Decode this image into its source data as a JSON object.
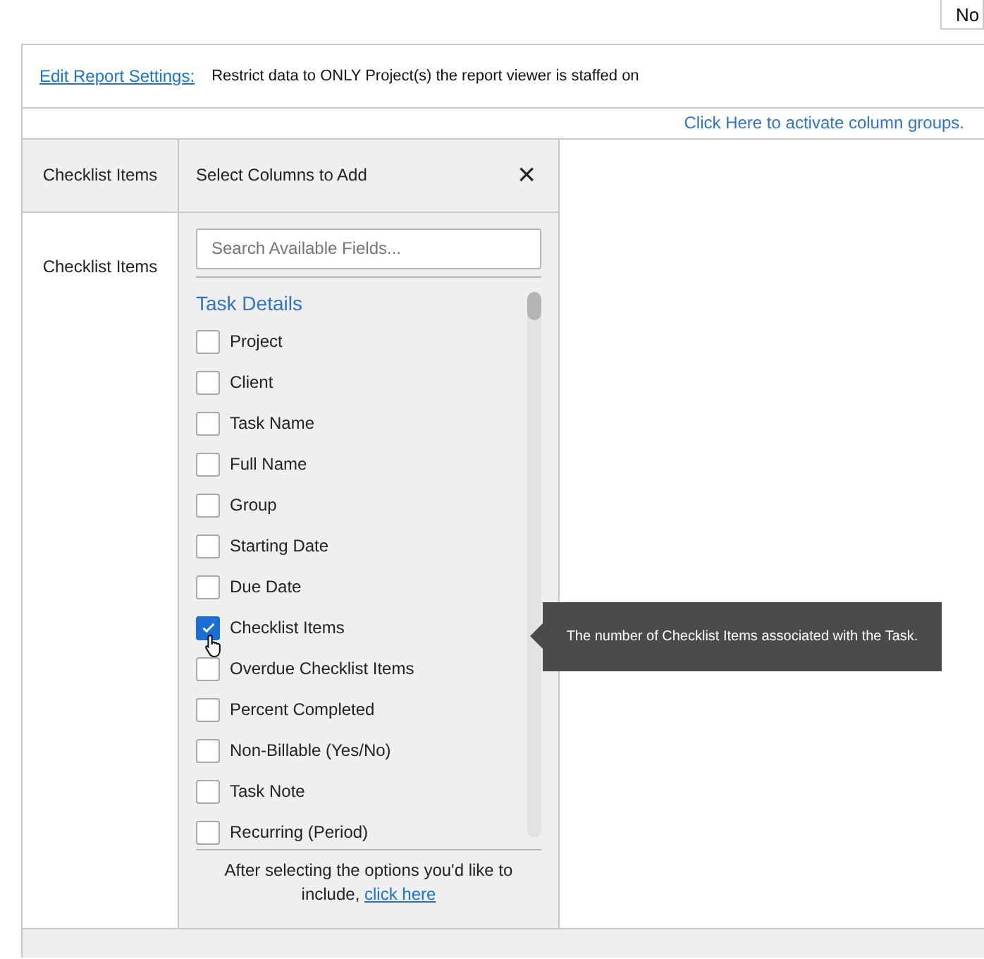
{
  "top_button": {
    "label": "No"
  },
  "report_settings": {
    "link": "Edit Report Settings:",
    "text": "Restrict data to ONLY Project(s) the report viewer is staffed on"
  },
  "column_groups_link": "Click Here to activate column groups.",
  "table": {
    "columns": [
      "Checklist Items"
    ],
    "rows": [
      [
        "Checklist Items"
      ]
    ]
  },
  "column_picker": {
    "title": "Select Columns to Add",
    "close": "×",
    "search": {
      "placeholder": "Search Available Fields..."
    },
    "section": "Task Details",
    "fields": [
      {
        "label": "Project",
        "checked": false
      },
      {
        "label": "Client",
        "checked": false
      },
      {
        "label": "Task Name",
        "checked": false
      },
      {
        "label": "Full Name",
        "checked": false
      },
      {
        "label": "Group",
        "checked": false
      },
      {
        "label": "Starting Date",
        "checked": false
      },
      {
        "label": "Due Date",
        "checked": false
      },
      {
        "label": "Checklist Items",
        "checked": true
      },
      {
        "label": "Overdue Checklist Items",
        "checked": false
      },
      {
        "label": "Percent Completed",
        "checked": false
      },
      {
        "label": "Non-Billable (Yes/No)",
        "checked": false
      },
      {
        "label": "Task Note",
        "checked": false
      },
      {
        "label": "Recurring (Period)",
        "checked": false
      }
    ],
    "footer_text": "After selecting the options you'd like to include,",
    "footer_link": "click here"
  },
  "tooltip": "The number of Checklist Items associated with the Task."
}
